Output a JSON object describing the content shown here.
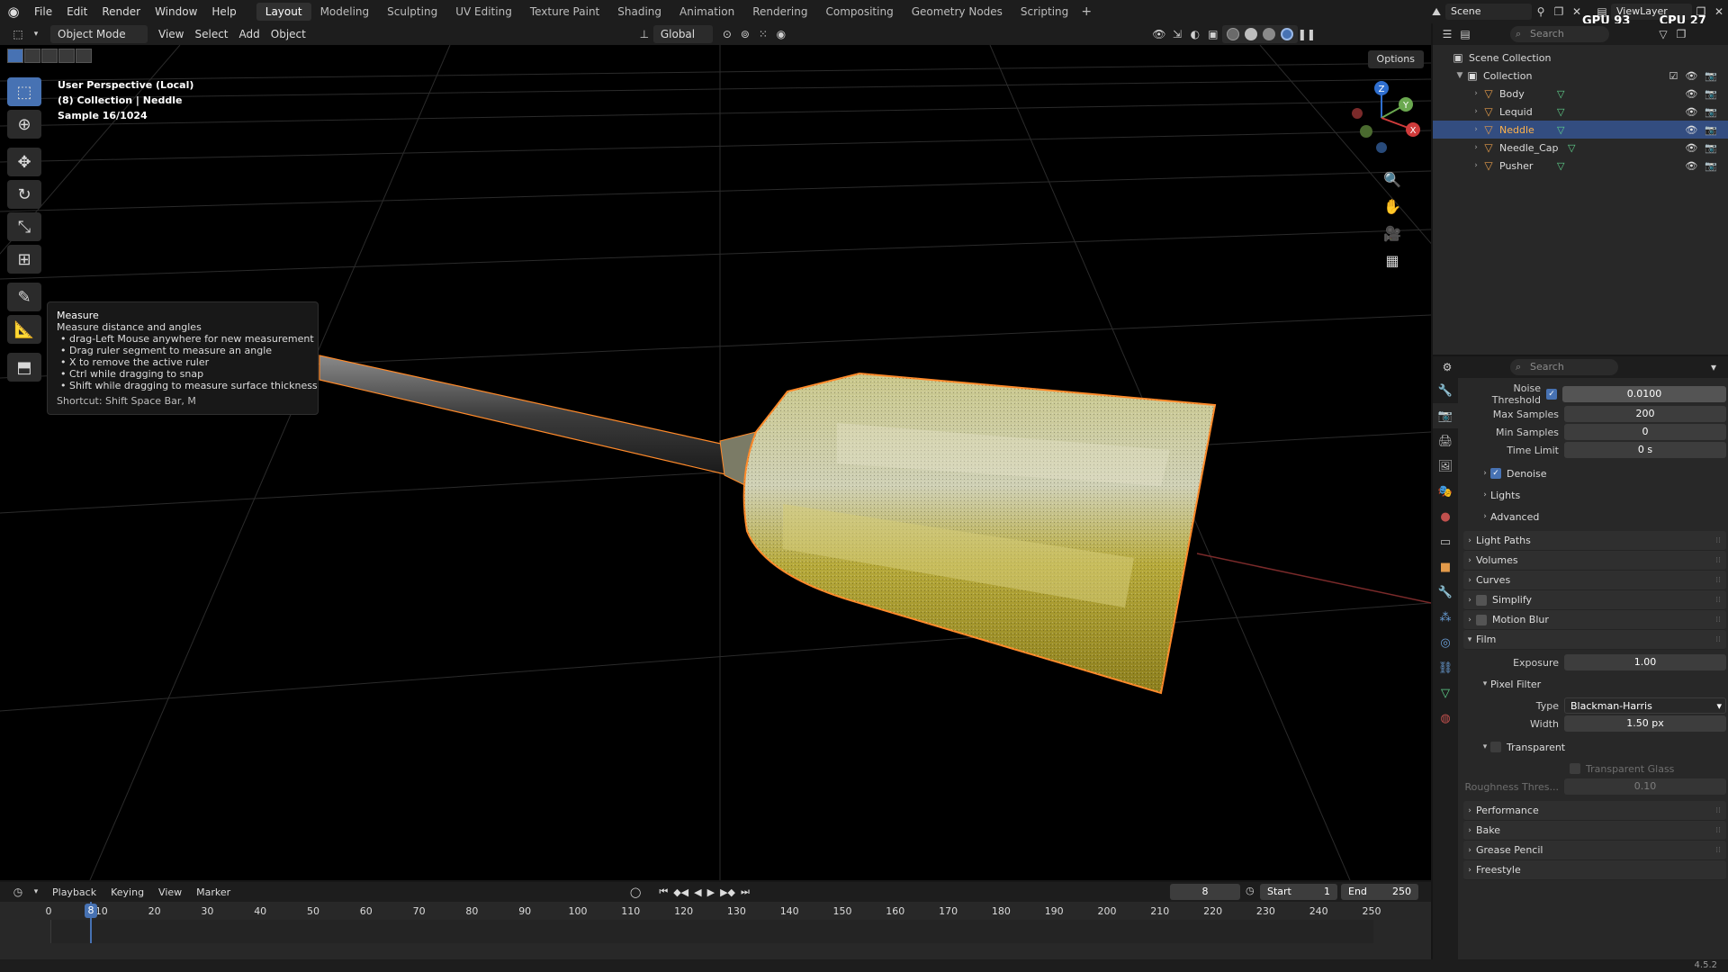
{
  "menubar": {
    "menus": [
      "File",
      "Edit",
      "Render",
      "Window",
      "Help"
    ],
    "workspaces": [
      "Layout",
      "Modeling",
      "Sculpting",
      "UV Editing",
      "Texture Paint",
      "Shading",
      "Animation",
      "Rendering",
      "Compositing",
      "Geometry Nodes",
      "Scripting"
    ],
    "active_workspace": "Layout",
    "scene": "Scene",
    "view_layer": "ViewLayer",
    "gpu": "GPU 93 %",
    "cpu": "CPU 27 %"
  },
  "viewport_header": {
    "mode": "Object Mode",
    "menus": [
      "View",
      "Select",
      "Add",
      "Object"
    ],
    "orientation": "Global",
    "options": "Options"
  },
  "viewport": {
    "line1": "User Perspective (Local)",
    "line2": "(8) Collection | Neddle",
    "line3": "Sample 16/1024"
  },
  "tooltip": {
    "title": "Measure",
    "description": "Measure distance and angles",
    "lines": [
      "• drag-Left Mouse anywhere for new measurement",
      "• Drag ruler segment to measure an angle",
      "• X to remove the active ruler",
      "• Ctrl while dragging to snap",
      "• Shift while dragging to measure surface thickness"
    ],
    "shortcut": "Shortcut: Shift Space Bar, M"
  },
  "gizmo": {
    "z": "Z",
    "y": "Y",
    "x": "X"
  },
  "outliner": {
    "search_placeholder": "Search",
    "scene_collection": "Scene Collection",
    "collection": "Collection",
    "objects": [
      "Body",
      "Lequid",
      "Neddle",
      "Needle_Cap",
      "Pusher"
    ],
    "selected": "Neddle"
  },
  "properties": {
    "search_placeholder": "Search",
    "noise_threshold": {
      "label": "Noise Threshold",
      "value": "0.0100"
    },
    "max_samples": {
      "label": "Max Samples",
      "value": "200"
    },
    "min_samples": {
      "label": "Min Samples",
      "value": "0"
    },
    "time_limit": {
      "label": "Time Limit",
      "value": "0 s"
    },
    "denoise": "Denoise",
    "lights": "Lights",
    "advanced": "Advanced",
    "light_paths": "Light Paths",
    "volumes": "Volumes",
    "curves": "Curves",
    "simplify": "Simplify",
    "motion_blur": "Motion Blur",
    "film": "Film",
    "exposure": {
      "label": "Exposure",
      "value": "1.00"
    },
    "pixel_filter": "Pixel Filter",
    "filter_type": {
      "label": "Type",
      "value": "Blackman-Harris"
    },
    "filter_width": {
      "label": "Width",
      "value": "1.50 px"
    },
    "transparent": "Transparent",
    "transparent_glass": "Transparent Glass",
    "roughness": {
      "label": "Roughness Thres...",
      "value": "0.10"
    },
    "performance": "Performance",
    "bake": "Bake",
    "grease_pencil": "Grease Pencil",
    "freestyle": "Freestyle"
  },
  "timeline": {
    "menus": [
      "Playback",
      "Keying",
      "View",
      "Marker"
    ],
    "current_frame": "8",
    "start_label": "Start",
    "start": "1",
    "end_label": "End",
    "end": "250",
    "ticks": [
      "0",
      "10",
      "20",
      "30",
      "40",
      "50",
      "60",
      "70",
      "80",
      "90",
      "100",
      "110",
      "120",
      "130",
      "140",
      "150",
      "160",
      "170",
      "180",
      "190",
      "200",
      "210",
      "220",
      "230",
      "240",
      "250"
    ]
  },
  "status": {
    "version": "4.5.2"
  },
  "colors": {
    "accent": "#4772b3",
    "selection_orange": "#ffb24a",
    "object_icon": "#e39a4a",
    "mesh_icon": "#5fd18b"
  }
}
